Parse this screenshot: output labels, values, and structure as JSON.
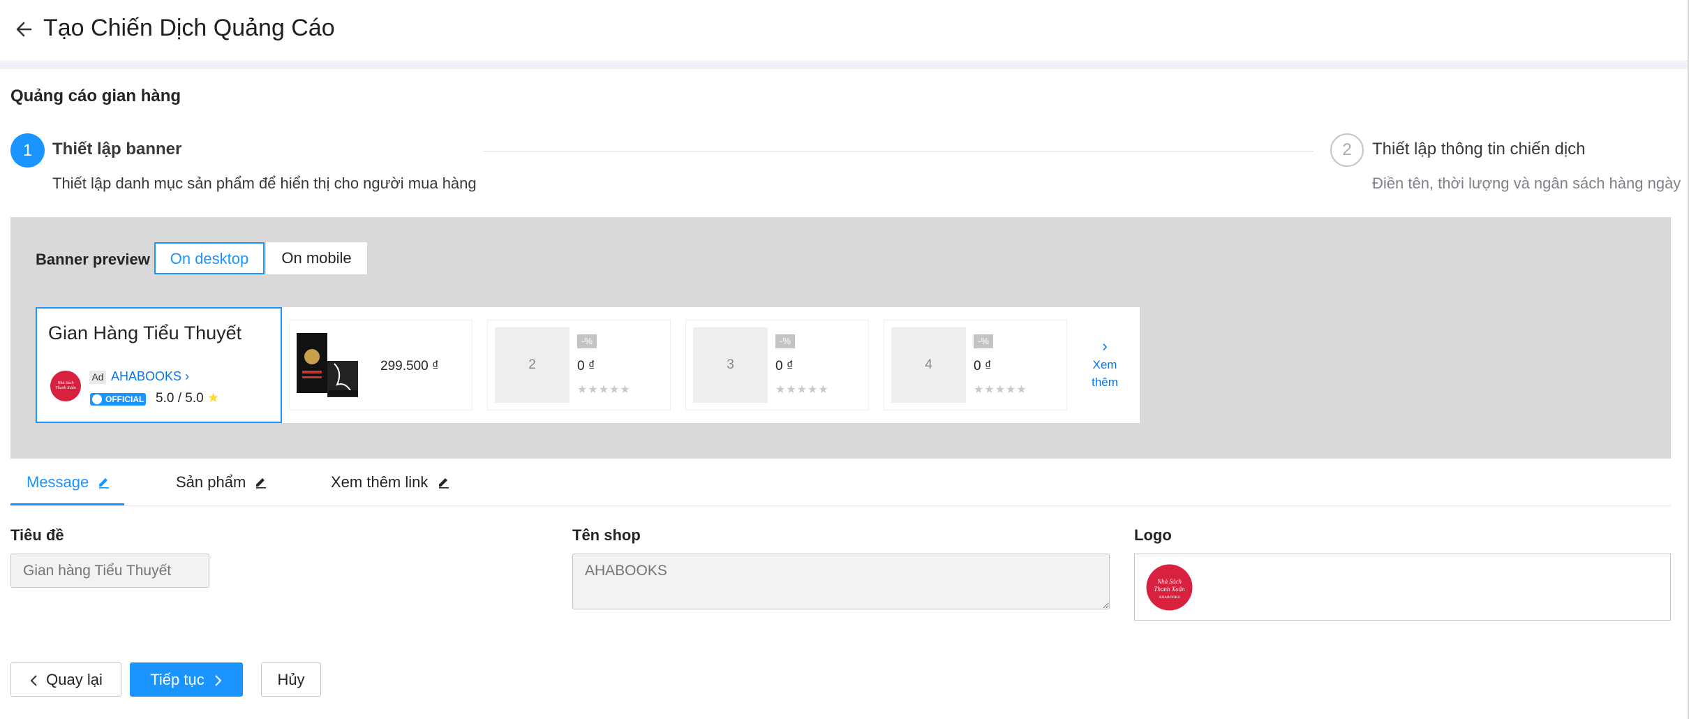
{
  "header": {
    "title": "Tạo Chiến Dịch Quảng Cáo"
  },
  "section_title": "Quảng cáo gian hàng",
  "steps": [
    {
      "number": "1",
      "title": "Thiết lập banner",
      "desc": "Thiết lập danh mục sản phẩm để hiển thị cho người mua hàng",
      "active": true
    },
    {
      "number": "2",
      "title": "Thiết lập thông tin chiến dịch",
      "desc": "Điền tên, thời lượng và ngân sách hàng ngày",
      "active": false
    }
  ],
  "preview": {
    "label": "Banner preview",
    "toggle_desktop": "On desktop",
    "toggle_mobile": "On mobile",
    "selected": "On desktop"
  },
  "banner": {
    "shop_title": "Gian Hàng Tiểu Thuyết",
    "ad_label": "Ad",
    "shop_name": "AHABOOKS",
    "official_label": "OFFICIAL",
    "rating": "5.0 / 5.0",
    "products": [
      {
        "price": "299.500 ₫",
        "has_image": true
      },
      {
        "thumb": "2",
        "discount": "-%",
        "price": "0 ₫",
        "stars": "★★★★★"
      },
      {
        "thumb": "3",
        "discount": "-%",
        "price": "0 ₫",
        "stars": "★★★★★"
      },
      {
        "thumb": "4",
        "discount": "-%",
        "price": "0 ₫",
        "stars": "★★★★★"
      }
    ],
    "see_more_line1": "Xem",
    "see_more_line2": "thêm"
  },
  "tabs": [
    {
      "label": "Message",
      "active": true
    },
    {
      "label": "Sản phẩm",
      "active": false
    },
    {
      "label": "Xem thêm link",
      "active": false
    }
  ],
  "form": {
    "title_label": "Tiêu đề",
    "title_placeholder": "Gian hàng Tiểu Thuyết",
    "shop_label": "Tên shop",
    "shop_placeholder": "AHABOOKS",
    "logo_label": "Logo",
    "logo_text_1": "Nhà Sách",
    "logo_text_2": "Thanh Xuân",
    "logo_text_3": "AHABOOKS"
  },
  "buttons": {
    "back": "Quay lại",
    "next": "Tiếp tục",
    "cancel": "Hủy"
  },
  "colors": {
    "accent": "#1a94ff",
    "link": "#0b74e5",
    "logo_red": "#d7213f",
    "panel_gray": "#d9d9d9"
  }
}
